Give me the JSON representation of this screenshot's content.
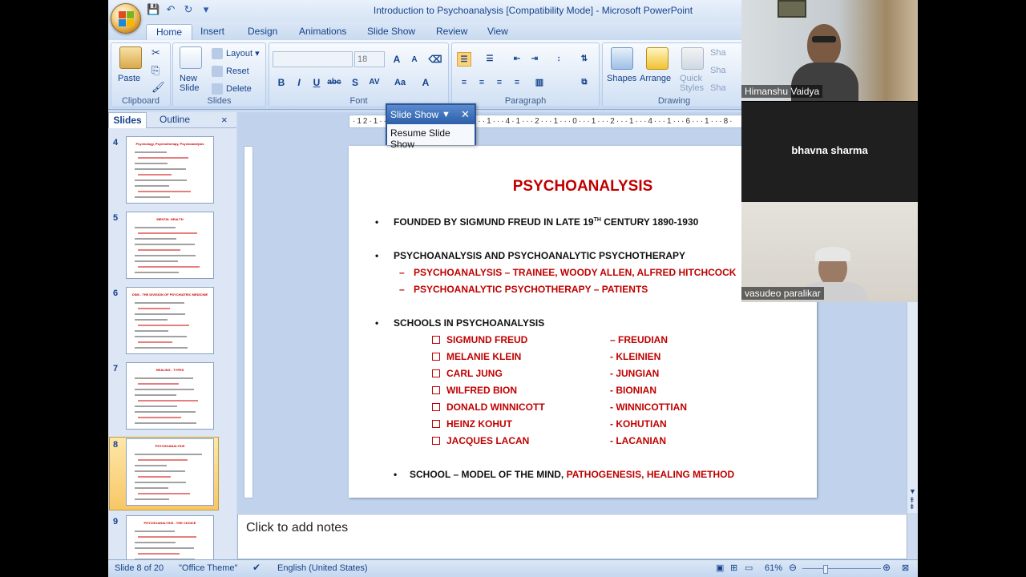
{
  "window": {
    "title": "Introduction to Psychoanalysis [Compatibility Mode] - Microsoft PowerPoint"
  },
  "tabs": [
    "Home",
    "Insert",
    "Design",
    "Animations",
    "Slide Show",
    "Review",
    "View"
  ],
  "ribbon": {
    "clipboard": {
      "label": "Clipboard",
      "paste": "Paste"
    },
    "slides": {
      "label": "Slides",
      "new_slide": "New\nSlide",
      "layout": "Layout",
      "reset": "Reset",
      "delete": "Delete"
    },
    "font": {
      "label": "Font",
      "size": "18"
    },
    "paragraph": {
      "label": "Paragraph"
    },
    "drawing": {
      "label": "Drawing",
      "shapes": "Shapes",
      "arrange": "Arrange",
      "quick_styles": "Quick\nStyles",
      "sha1": "Sha",
      "sha2": "Sha",
      "sha3": "Sha"
    }
  },
  "panel": {
    "slides_tab": "Slides",
    "outline_tab": "Outline",
    "close": "×"
  },
  "thumbnails": [
    {
      "num": "4",
      "title": "Psychology, Psychotherapy, Psychoanalysis"
    },
    {
      "num": "5",
      "title": "MENTAL HEALTH"
    },
    {
      "num": "6",
      "title": "DSM - THE DIVISION OF PSYCHIATRIC MEDICINE"
    },
    {
      "num": "7",
      "title": "HEALING - TYPES"
    },
    {
      "num": "8",
      "title": "PSYCHOANALYSIS"
    },
    {
      "num": "9",
      "title": "PSYCHOANALYSIS - THE CHOICE"
    }
  ],
  "popup": {
    "title": "Slide Show",
    "resume": "Resume Slide Show"
  },
  "ruler": "·12·1···1···1···1···1···1···1···4·1···2···1···0···1···2···1···4···1···6···1···8·",
  "slide": {
    "title": "PSYCHOANALYSIS",
    "bullet1_a": "FOUNDED BY SIGMUND FREUD IN LATE 19",
    "bullet1_sup": "TH",
    "bullet1_b": " CENTURY 1890-1930",
    "bullet2": "PSYCHOANALYSIS AND PSYCHOANALYTIC PSYCHOTHERAPY",
    "sub1": "PSYCHOANALYSIS – TRAINEE, WOODY ALLEN,  ALFRED HITCHCOCK",
    "sub2": "PSYCHOANALYTIC PSYCHOTHERAPY – PATIENTS",
    "bullet3": "SCHOOLS IN PSYCHOANALYSIS",
    "schools": [
      {
        "name": "SIGMUND FREUD",
        "school": "– FREUDIAN"
      },
      {
        "name": "MELANIE KLEIN",
        "school": "-  KLEINIEN"
      },
      {
        "name": "CARL JUNG",
        "school": "-  JUNGIAN"
      },
      {
        "name": "WILFRED BION",
        "school": "-  BIONIAN"
      },
      {
        "name": "DONALD WINNICOTT",
        "school": "-  WINNICOTTIAN"
      },
      {
        "name": "HEINZ KOHUT",
        "school": "-  KOHUTIAN"
      },
      {
        "name": "JACQUES LACAN",
        "school": "-  LACANIAN"
      }
    ],
    "bullet4_a": "SCHOOL – MODEL OF THE MIND, ",
    "bullet4_b": "PATHOGENESIS, HEALING METHOD",
    "bullet_char": "•",
    "dash_char": "–"
  },
  "notes": {
    "placeholder": "Click to add notes"
  },
  "status": {
    "slide": "Slide 8 of 20",
    "theme": "\"Office Theme\"",
    "language": "English (United States)",
    "zoom": "61%"
  },
  "participants": [
    {
      "name": "Himanshu Vaidya"
    },
    {
      "name": "bhavna sharma"
    },
    {
      "name": "vasudeo paralikar"
    }
  ]
}
